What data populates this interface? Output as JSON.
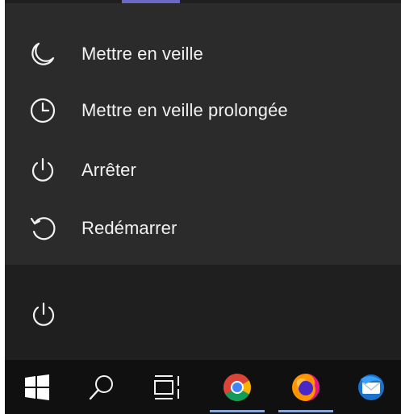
{
  "power_menu": {
    "items": [
      {
        "label": "Mettre en veille",
        "icon": "moon-icon"
      },
      {
        "label": "Mettre en veille prolongée",
        "icon": "clock-icon"
      },
      {
        "label": "Arrêter",
        "icon": "power-icon"
      },
      {
        "label": "Redémarrer",
        "icon": "restart-icon"
      }
    ]
  },
  "start_menu": {
    "power_button_icon": "power-icon"
  },
  "taskbar": {
    "items": [
      {
        "icon": "windows-logo-icon"
      },
      {
        "icon": "search-icon"
      },
      {
        "icon": "task-view-icon"
      },
      {
        "icon": "chrome-icon"
      },
      {
        "icon": "firefox-icon"
      },
      {
        "icon": "thunderbird-icon"
      }
    ]
  },
  "colors": {
    "menu_background": "#2b2b2b",
    "start_background": "#1f1f1f",
    "taskbar_background": "#101010",
    "accent": "#6b69c6",
    "text": "#f2f2f2"
  }
}
